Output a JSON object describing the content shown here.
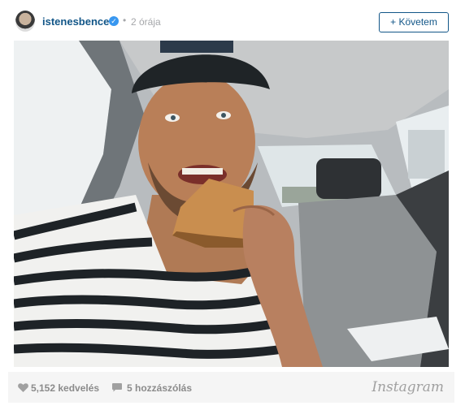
{
  "post": {
    "username": "istenesbence",
    "verified_icon": "verified-check-icon",
    "separator": "•",
    "time_ago": "2 órája",
    "follow_label": "+ Követem"
  },
  "stats": {
    "likes": "5,152 kedvelés",
    "comments": "5 hozzászólás"
  },
  "brand": "Instagram",
  "colors": {
    "link": "#125688",
    "verified": "#3897f0",
    "muted": "#a5a7aa",
    "footer_bg": "#f5f5f5"
  }
}
